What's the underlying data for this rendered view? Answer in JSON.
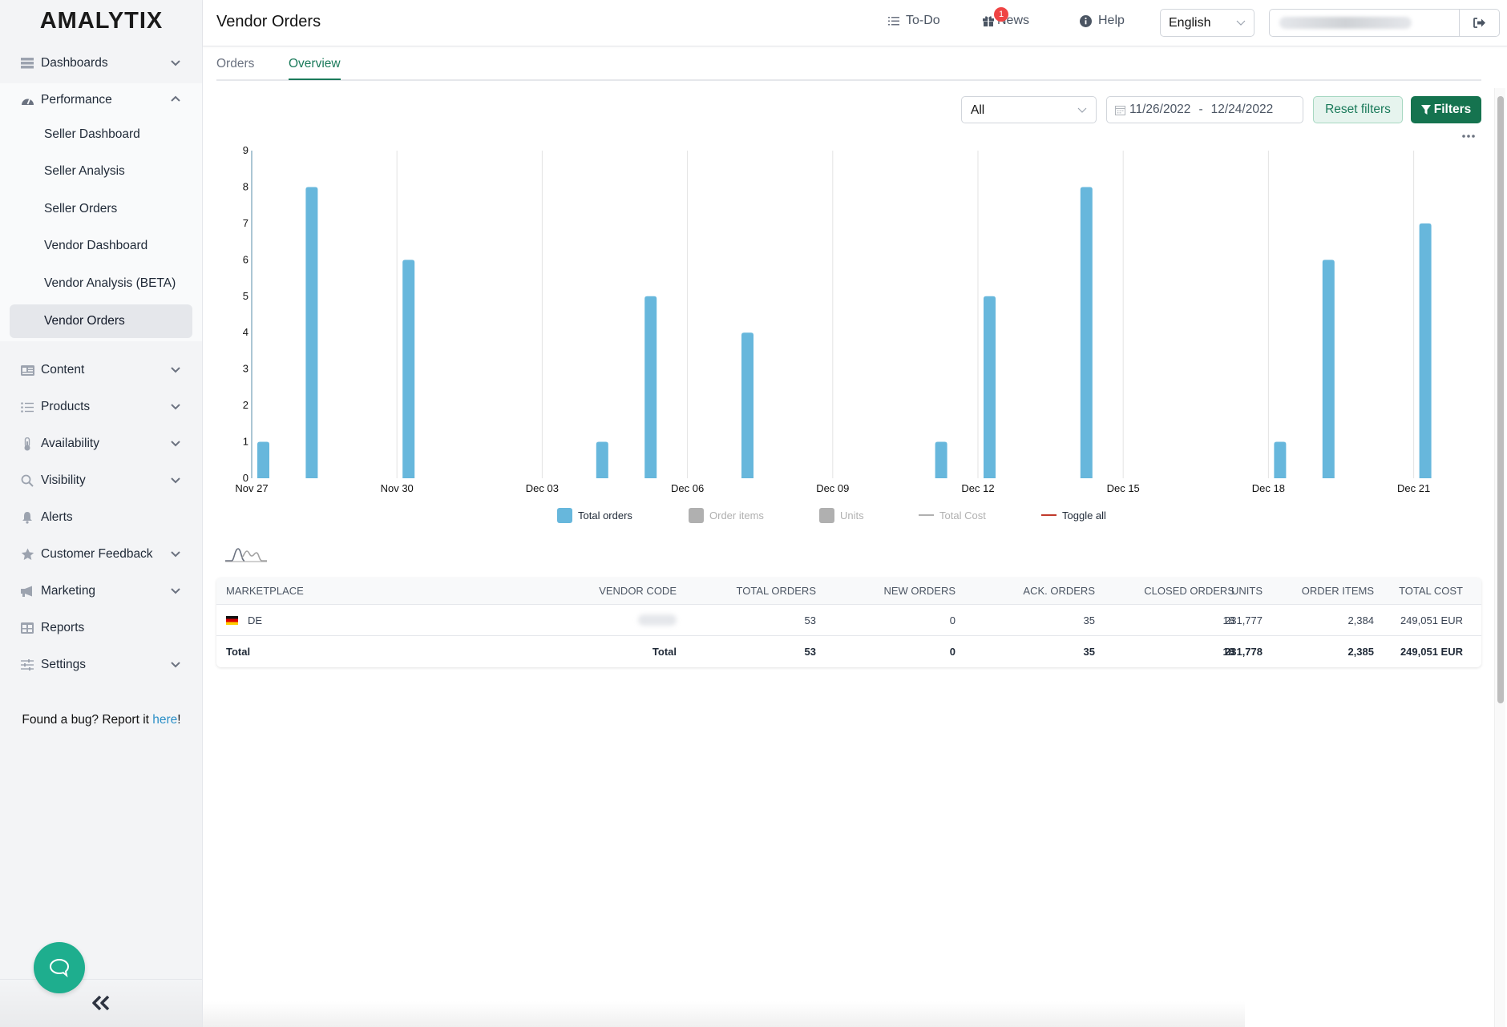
{
  "app": {
    "logo": "AMALYTIX",
    "page_title": "Vendor Orders"
  },
  "header": {
    "todo_label": "To-Do",
    "news_label": "News",
    "news_badge": "1",
    "help_label": "Help",
    "language": "English"
  },
  "sidebar": {
    "sections": [
      {
        "label": "Dashboards",
        "icon": "dashboard-icon",
        "expandable": true,
        "expanded": false
      },
      {
        "label": "Performance",
        "icon": "gauge-icon",
        "expandable": true,
        "expanded": true
      },
      {
        "label": "Content",
        "icon": "id-card-icon",
        "expandable": true,
        "expanded": false
      },
      {
        "label": "Products",
        "icon": "list-icon",
        "expandable": true,
        "expanded": false
      },
      {
        "label": "Availability",
        "icon": "thermometer-icon",
        "expandable": true,
        "expanded": false
      },
      {
        "label": "Visibility",
        "icon": "search-icon",
        "expandable": true,
        "expanded": false
      },
      {
        "label": "Alerts",
        "icon": "bell-icon",
        "expandable": false,
        "expanded": false
      },
      {
        "label": "Customer Feedback",
        "icon": "star-icon",
        "expandable": true,
        "expanded": false
      },
      {
        "label": "Marketing",
        "icon": "megaphone-icon",
        "expandable": true,
        "expanded": false
      },
      {
        "label": "Reports",
        "icon": "table-icon",
        "expandable": false,
        "expanded": false
      },
      {
        "label": "Settings",
        "icon": "sliders-icon",
        "expandable": true,
        "expanded": false
      }
    ],
    "performance_items": [
      {
        "label": "Seller Dashboard",
        "active": false
      },
      {
        "label": "Seller Analysis",
        "active": false
      },
      {
        "label": "Seller Orders",
        "active": false
      },
      {
        "label": "Vendor Dashboard",
        "active": false
      },
      {
        "label": "Vendor Analysis (BETA)",
        "active": false
      },
      {
        "label": "Vendor Orders",
        "active": true
      }
    ],
    "bug_text": "Found a bug? Report it ",
    "bug_link": "here",
    "bug_suffix": "!"
  },
  "tabs": [
    {
      "label": "Orders",
      "active": false
    },
    {
      "label": "Overview",
      "active": true
    }
  ],
  "filters": {
    "marketplace_select": "All",
    "date_from": "11/26/2022",
    "date_separator": "-",
    "date_to": "12/24/2022",
    "reset_label": "Reset filters",
    "filters_label": "Filters"
  },
  "colors": {
    "accent": "#15734f",
    "bar": "#67b7dc",
    "legend_inactive": "#b0b0b0",
    "toggle_all_line": "#c0392b"
  },
  "chart_data": {
    "type": "bar",
    "title": "",
    "xlabel": "",
    "ylabel": "",
    "ylim": [
      0,
      9
    ],
    "yticks": [
      0,
      1,
      2,
      3,
      4,
      5,
      6,
      7,
      8,
      9
    ],
    "x_range": [
      "2022-11-27",
      "2022-12-22"
    ],
    "xtick_labels": [
      "Nov 27",
      "Nov 30",
      "Dec 03",
      "Dec 06",
      "Dec 09",
      "Dec 12",
      "Dec 15",
      "Dec 18",
      "Dec 21"
    ],
    "xtick_day_offsets": [
      0,
      3,
      6,
      9,
      12,
      15,
      18,
      21,
      24
    ],
    "grid": "vertical",
    "series": [
      {
        "name": "Total orders",
        "visible": true,
        "points": [
          {
            "date": "Nov 27",
            "day_offset": 0,
            "value": 1
          },
          {
            "date": "Nov 28",
            "day_offset": 1,
            "value": 8
          },
          {
            "date": "Nov 30",
            "day_offset": 3,
            "value": 6
          },
          {
            "date": "Dec 04",
            "day_offset": 7,
            "value": 1
          },
          {
            "date": "Dec 05",
            "day_offset": 8,
            "value": 5
          },
          {
            "date": "Dec 07",
            "day_offset": 10,
            "value": 4
          },
          {
            "date": "Dec 11",
            "day_offset": 14,
            "value": 1
          },
          {
            "date": "Dec 12",
            "day_offset": 15,
            "value": 5
          },
          {
            "date": "Dec 14",
            "day_offset": 17,
            "value": 8
          },
          {
            "date": "Dec 18",
            "day_offset": 21,
            "value": 1
          },
          {
            "date": "Dec 19",
            "day_offset": 22,
            "value": 6
          },
          {
            "date": "Dec 21",
            "day_offset": 24,
            "value": 7
          }
        ]
      },
      {
        "name": "Order items",
        "visible": false
      },
      {
        "name": "Units",
        "visible": false
      },
      {
        "name": "Total Cost",
        "visible": false
      }
    ],
    "legend": {
      "placement": "bottom-center",
      "items": [
        {
          "label": "Total orders",
          "kind": "box",
          "active": true
        },
        {
          "label": "Order items",
          "kind": "box",
          "active": false
        },
        {
          "label": "Units",
          "kind": "box",
          "active": false
        },
        {
          "label": "Total Cost",
          "kind": "line",
          "active": false
        },
        {
          "label": "Toggle all",
          "kind": "line",
          "active": true
        }
      ]
    }
  },
  "table": {
    "columns": [
      "MARKETPLACE",
      "VENDOR CODE",
      "TOTAL ORDERS",
      "NEW ORDERS",
      "ACK. ORDERS",
      "CLOSED ORDERS",
      "ORDER ITEMS",
      "UNITS",
      "TOTAL COST"
    ],
    "rows": [
      {
        "marketplace": "DE",
        "vendor_code": "",
        "total_orders": "53",
        "new_orders": "0",
        "ack_orders": "35",
        "closed_orders": "18",
        "order_items": "2,384",
        "units": "231,777",
        "total_cost": "249,051 EUR"
      }
    ],
    "total": {
      "marketplace": "Total",
      "vendor_code": "Total",
      "total_orders": "53",
      "new_orders": "0",
      "ack_orders": "35",
      "closed_orders": "18",
      "order_items": "2,385",
      "units": "231,778",
      "total_cost": "249,051 EUR"
    }
  }
}
